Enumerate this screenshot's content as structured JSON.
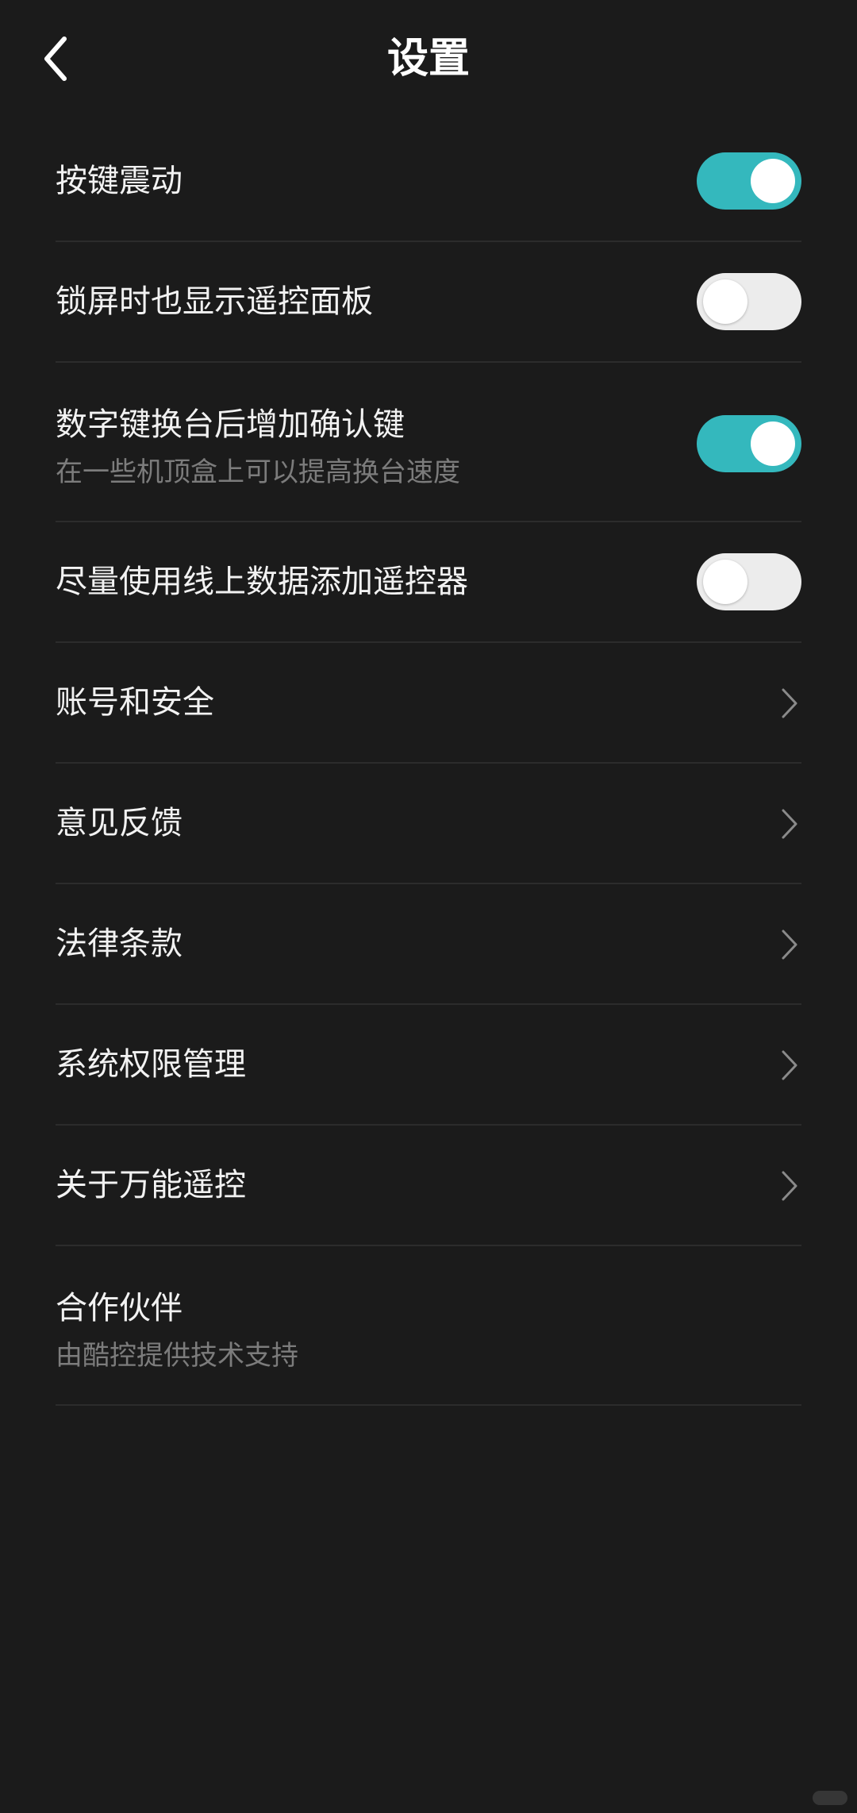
{
  "header": {
    "title": "设置",
    "back_icon": "chevron-left-icon"
  },
  "settings": {
    "toggles": [
      {
        "label": "按键震动",
        "enabled": true
      },
      {
        "label": "锁屏时也显示遥控面板",
        "enabled": false
      },
      {
        "label": "数字键换台后增加确认键",
        "subtitle": "在一些机顶盒上可以提高换台速度",
        "enabled": true
      },
      {
        "label": "尽量使用线上数据添加遥控器",
        "enabled": false
      }
    ],
    "links": [
      {
        "label": "账号和安全",
        "icon": "chevron-right-icon"
      },
      {
        "label": "意见反馈",
        "icon": "chevron-right-icon"
      },
      {
        "label": "法律条款",
        "icon": "chevron-right-icon"
      },
      {
        "label": "系统权限管理",
        "icon": "chevron-right-icon"
      },
      {
        "label": "关于万能遥控",
        "icon": "chevron-right-icon"
      }
    ],
    "partner": {
      "label": "合作伙伴",
      "subtitle": "由酷控提供技术支持"
    }
  },
  "colors": {
    "background": "#1b1b1b",
    "accent": "#34b8bd",
    "toggle_off": "#ececec",
    "divider": "#2c2c2c",
    "subtitle": "#7c7c7c"
  }
}
